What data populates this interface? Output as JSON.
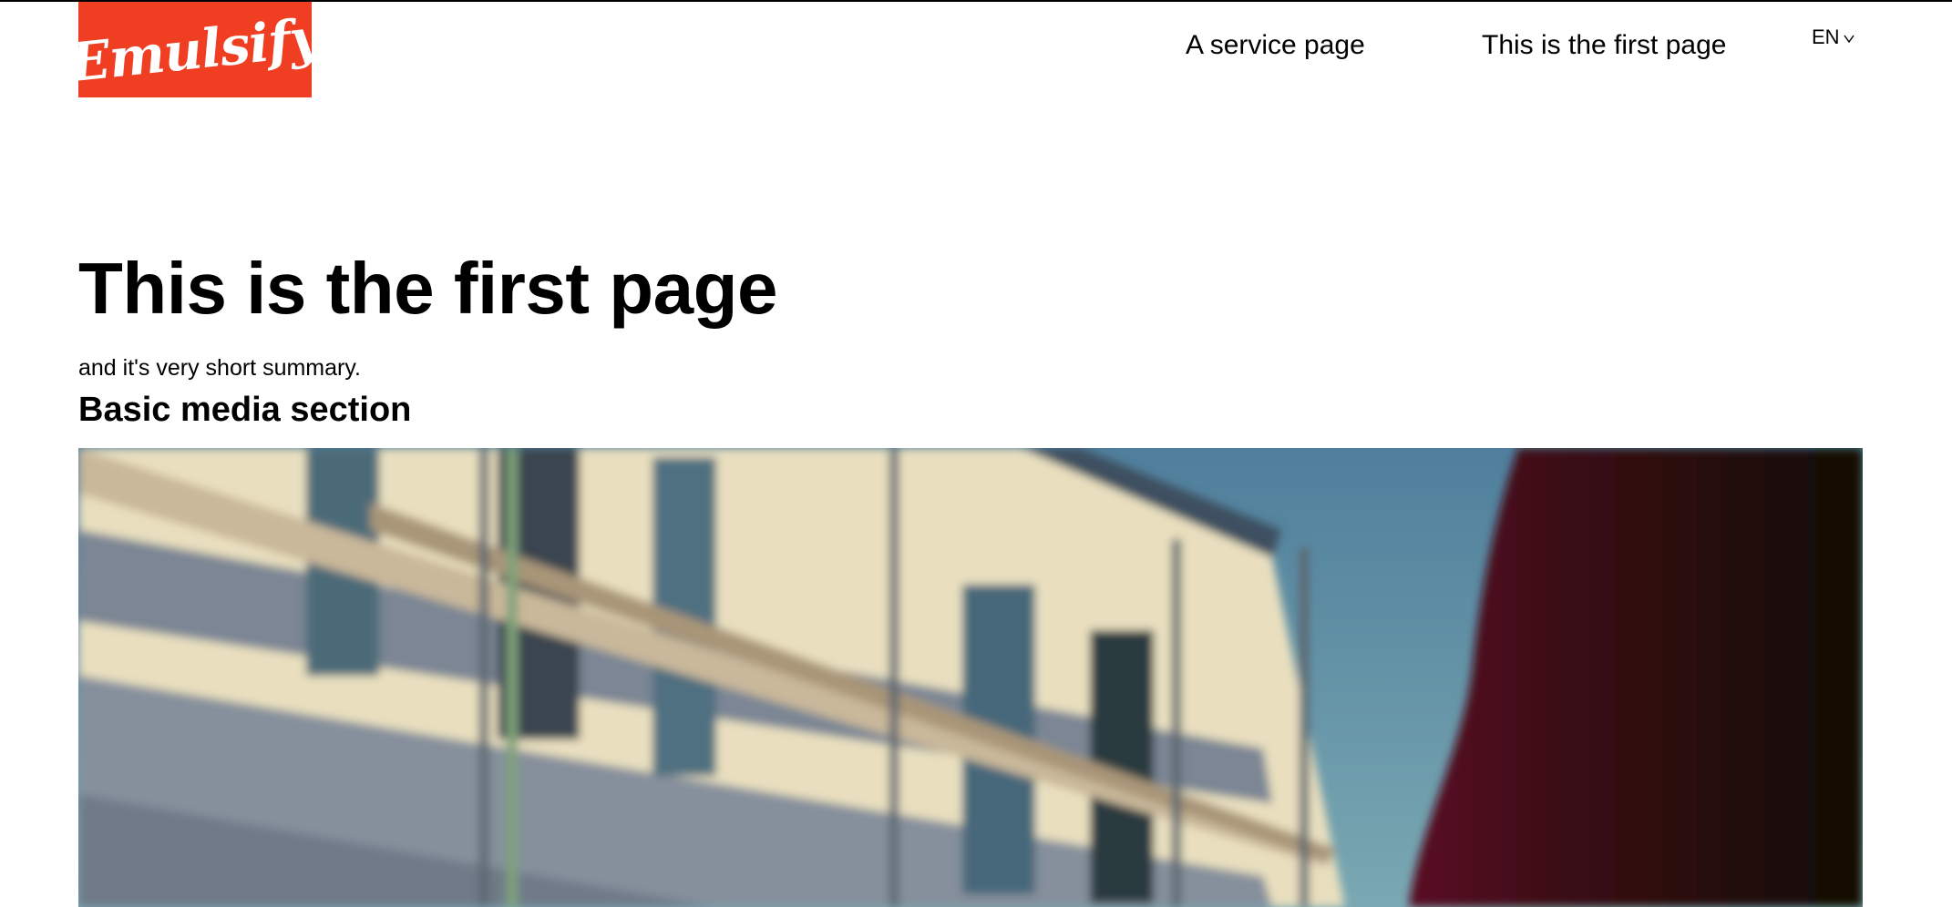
{
  "header": {
    "logo_text": "Emulsify",
    "brand_color": "#ef3e22",
    "nav": [
      {
        "label": "A service page"
      },
      {
        "label": "This is the first page"
      }
    ],
    "language": {
      "label": "EN",
      "icon": "chevron-down-icon"
    }
  },
  "main": {
    "title": "This is the first page",
    "summary": "and it's very short summary.",
    "media_section": {
      "title": "Basic media section"
    }
  }
}
